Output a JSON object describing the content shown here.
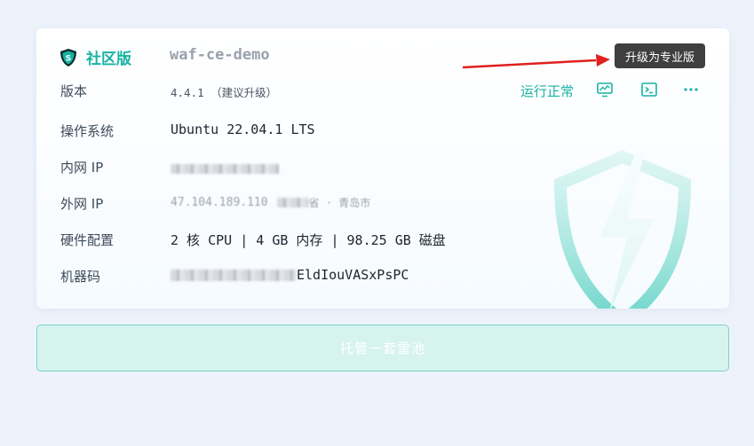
{
  "header": {
    "edition_label": "社区版",
    "instance_name": "waf-ce-demo",
    "tooltip": "升级为专业版",
    "status": "运行正常"
  },
  "info": {
    "version_label": "版本",
    "version_value": "4.4.1 （建议升级）",
    "os_label": "操作系统",
    "os_value": "Ubuntu 22.04.1 LTS",
    "lan_ip_label": "内网 IP",
    "wan_ip_label": "外网 IP",
    "wan_ip_value": "47.104.189.110",
    "wan_ip_region": "省 · 青岛市",
    "hardware_label": "硬件配置",
    "hardware_value": "2 核 CPU | 4 GB 内存 | 98.25 GB 磁盘",
    "machine_code_label": "机器码",
    "machine_code_value": "EldIouVASxPsPC"
  },
  "actions": {
    "pool_button": "托管一套雷池"
  },
  "colors": {
    "accent": "#17b3a3",
    "annotation_arrow": "#e02020"
  }
}
